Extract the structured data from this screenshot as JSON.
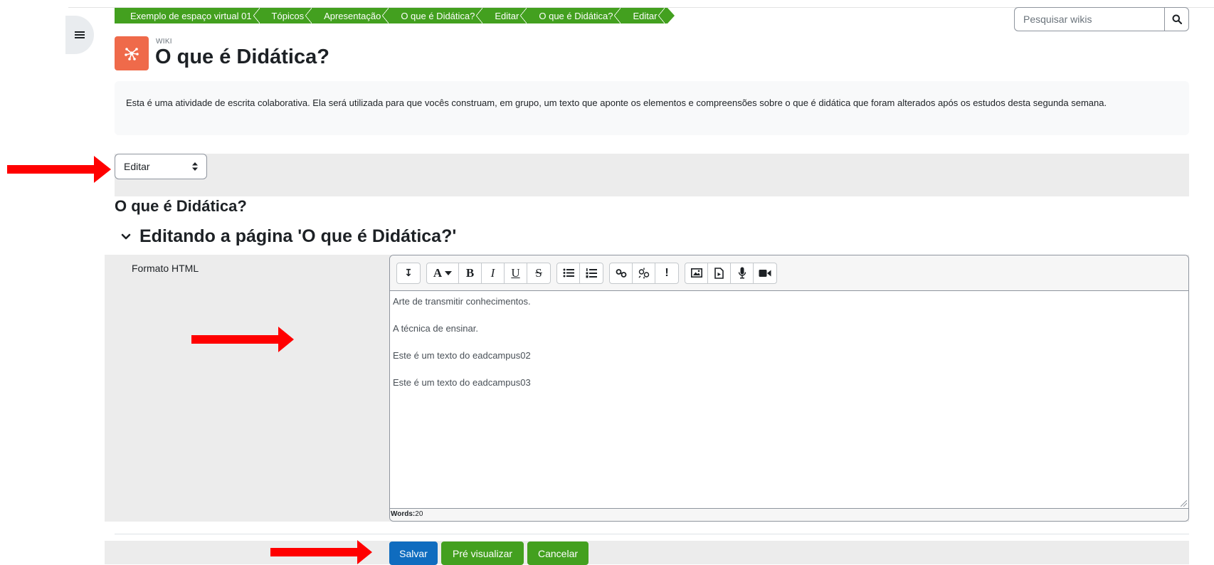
{
  "breadcrumb": [
    "Exemplo de espaço virtual 01",
    "Tópicos",
    "Apresentação",
    "O que é Didática?",
    "Editar",
    "O que é Didática?",
    "Editar"
  ],
  "search": {
    "placeholder": "Pesquisar wikis",
    "icon": "search-icon"
  },
  "drawer": {
    "icon": "list-icon"
  },
  "activity": {
    "label": "WIKI",
    "title": "O que é Didática?",
    "icon": "wiki-icon",
    "icon_color": "#ef6a4a",
    "description": "Esta é uma atividade de escrita colaborativa. Ela será utilizada para que vocês construam, em grupo, um texto que aponte os elementos e compreensões sobre o que é didática que foram alterados após os estudos desta segunda semana."
  },
  "mode_select": {
    "selected": "Editar"
  },
  "page_title": "O que é Didática?",
  "section_heading": "Editando a página 'O que é Didática?'",
  "form": {
    "field_label": "Formato HTML",
    "help_icon": "help-icon",
    "toolbar": {
      "collapse": "↧",
      "font_color": "A",
      "bold": "B",
      "italic": "I",
      "underline": "U",
      "strike": "S"
    },
    "content_lines": [
      "Arte de transmitir conhecimentos.",
      "A técnica de ensinar.",
      "Este é um texto do eadcampus02",
      "Este é um texto do eadcampus03"
    ],
    "word_count_label": "Words:",
    "word_count": "20"
  },
  "buttons": {
    "save": "Salvar",
    "preview": "Pré visualizar",
    "cancel": "Cancelar"
  },
  "colors": {
    "breadcrumb": "#43a01f",
    "primary": "#0f6cbf",
    "success": "#43a01f",
    "arrow": "#ff0000"
  }
}
